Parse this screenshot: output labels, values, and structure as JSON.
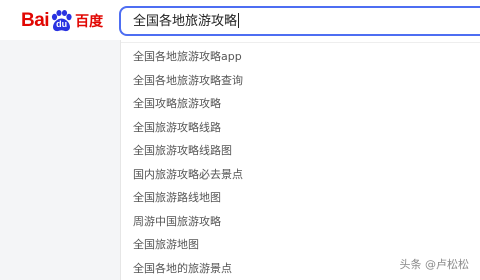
{
  "logo": {
    "latin_left": "Bai",
    "paw_text": "du",
    "chinese": "百度",
    "brand_color": "#e10602",
    "paw_icon": "baidu-paw-icon"
  },
  "search": {
    "value": "全国各地旅游攻略",
    "border_color": "#4e6ef2"
  },
  "suggestions": [
    "全国各地旅游攻略app",
    "全国各地旅游攻略查询",
    "全国攻略旅游攻略",
    "全国旅游攻略线路",
    "全国旅游攻略线路图",
    "国内旅游攻略必去景点",
    "全国旅游路线地图",
    "周游中国旅游攻略",
    "全国旅游地图",
    "全国各地的旅游景点"
  ],
  "watermark": "头条 @卢松松"
}
